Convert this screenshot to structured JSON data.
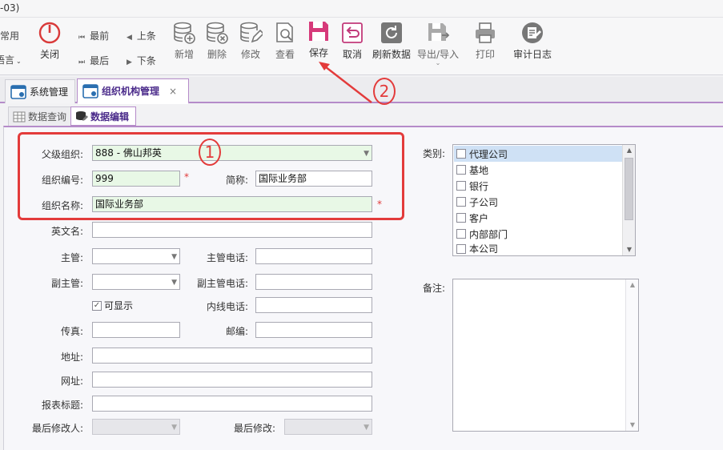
{
  "window": {
    "title_fragment": "-03)"
  },
  "ribbon": {
    "left_partial": {
      "top": "常用",
      "bottom": "语言"
    },
    "close": "关闭",
    "nav": {
      "first": "最前",
      "prev": "上条",
      "last": "最后",
      "next": "下条"
    },
    "buttons": {
      "add": "新增",
      "delete": "删除",
      "edit": "修改",
      "view": "查看",
      "save": "保存",
      "cancel": "取消",
      "refresh": "刷新数据",
      "import_export": "导出/导入",
      "print": "打印",
      "audit_log": "审计日志"
    }
  },
  "tabs": {
    "system": "系统管理",
    "org": "组织机构管理",
    "close_glyph": "×"
  },
  "subtabs": {
    "query": "数据查询",
    "edit": "数据编辑"
  },
  "annotations": {
    "one": "1",
    "two": "2",
    "accent": "#e33b3b"
  },
  "form": {
    "parent_org_label": "父级组织:",
    "parent_org_value": "888 - 佛山邦英",
    "org_code_label": "组织编号:",
    "org_code_value": "999",
    "short_name_label": "简称:",
    "short_name_value": "国际业务部",
    "org_name_label": "组织名称:",
    "org_name_value": "国际业务部",
    "english_name_label": "英文名:",
    "manager_label": "主管:",
    "manager_phone_label": "主管电话:",
    "deputy_label": "副主管:",
    "deputy_phone_label": "副主管电话:",
    "visible_label": "可显示",
    "ext_phone_label": "内线电话:",
    "fax_label": "传真:",
    "postcode_label": "邮编:",
    "address_label": "地址:",
    "website_label": "网址:",
    "report_title_label": "报表标题:",
    "last_modifier_label": "最后修改人:",
    "last_modified_label": "最后修改:",
    "required_mark": "*",
    "category_label": "类别:",
    "categories": [
      "代理公司",
      "基地",
      "银行",
      "子公司",
      "客户",
      "内部部门",
      "本公司"
    ],
    "remark_label": "备注:"
  }
}
